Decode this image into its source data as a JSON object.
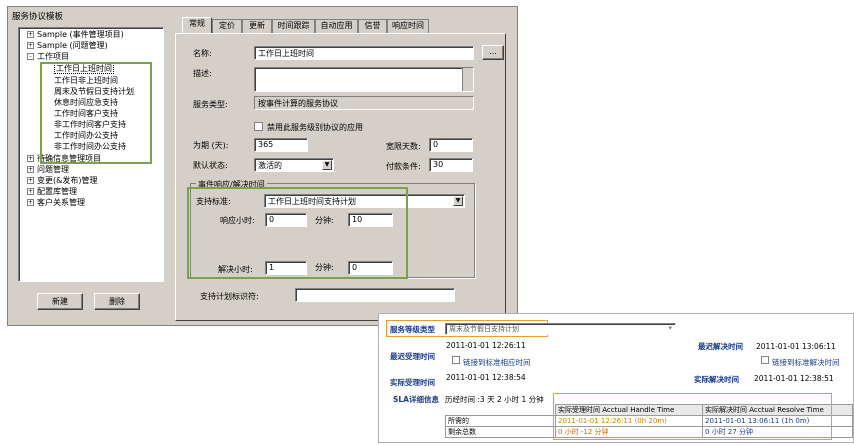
{
  "window": {
    "panel_title": "服务协议模板",
    "new_button": "新建",
    "delete_button": "删除"
  },
  "tree": {
    "items": [
      {
        "label": "Sample (事件管理项目)",
        "expander": "+"
      },
      {
        "label": "Sample (问题管理)",
        "expander": "+"
      },
      {
        "label": "工作项目",
        "expander": "-"
      },
      {
        "label": "工作日上班时间",
        "selected": true
      },
      {
        "label": "工作日非上班时间"
      },
      {
        "label": "周末及节假日支持计划"
      },
      {
        "label": "休息时间应急支持"
      },
      {
        "label": "工作时间客户支持"
      },
      {
        "label": "非工作时间客户支持"
      },
      {
        "label": "工作时间办公支持"
      },
      {
        "label": "非工作时间办公支持"
      },
      {
        "label": "待确信息管理项目",
        "expander": "+"
      },
      {
        "label": "问题管理",
        "expander": "+"
      },
      {
        "label": "变更(&发布)管理",
        "expander": "+"
      },
      {
        "label": "配置库管理",
        "expander": "+"
      },
      {
        "label": "客户关系管理",
        "expander": "+"
      }
    ]
  },
  "tabs": [
    "常规",
    "定价",
    "更新",
    "时间跟踪",
    "自动应用",
    "信誉",
    "响应时间"
  ],
  "form": {
    "name_label": "名称:",
    "name_value": "工作日上班时间",
    "browse_button": "...",
    "desc_label": "描述:",
    "desc_value": "",
    "service_type_label": "服务类型:",
    "service_type_value": "按事件计算的服务协议",
    "disable_label": "禁用此服务级别协议的应用",
    "period_label": "为期 (天):",
    "period_value": "365",
    "grace_label": "宽限天数:",
    "grace_value": "0",
    "default_state_label": "默认状态:",
    "default_state_value": "激活的",
    "payment_label": "付款条件:",
    "payment_value": "30",
    "group_title": "事件响应/解决时间",
    "support_label": "支持标准:",
    "support_value": "工作日上班时间支持计划",
    "resp_hours_label": "响应小时:",
    "resp_hours_value": "0",
    "resp_min_label": "分钟:",
    "resp_min_value": "10",
    "resolve_hours_label": "解决小时:",
    "resolve_hours_value": "1",
    "resolve_min_label": "分钟:",
    "resolve_min_value": "0",
    "plan_id_label": "支持计划标识符:",
    "plan_id_value": ""
  },
  "web": {
    "level_type_label": "服务等级类型",
    "level_type_value": "周末及节假日支持计划",
    "latest_handle_label": "最迟受理时间",
    "latest_handle_value": "2011-01-01 12:26:11",
    "link_handle_label": "链接到标准相应时间",
    "latest_resolve_label": "最迟解决时间",
    "latest_resolve_value": "2011-01-01 13:06:11",
    "link_resolve_label": "链接到标准解决时间",
    "actual_handle_label": "实际受理时间",
    "actual_handle_value": "2011-01-01 12:38:54",
    "actual_resolve_label": "实际解决时间",
    "actual_resolve_value": "2011-01-01 12:38:51",
    "sla_detail_label": "SLA详细信息",
    "elapsed_text": "历经时间 :3 天 2 小时 1 分钟",
    "table": {
      "col_handle": "实际受理时间   Acctual Handle Time",
      "col_resolve": "实际解决时间   Acctual Resolve Time",
      "row1_label": "所需的",
      "row1_handle": "2011-01-01 12:26:11 (0h 20m)",
      "row1_resolve": "2011-01-01 13:06:11 (1h 0m)",
      "row2_label": "剩余总数",
      "row2_handle": "0 小时 -12 分钟",
      "row2_resolve": "0 小时 27 分钟"
    }
  },
  "colors": {
    "green_highlight": "#7aa24a",
    "orange_highlight": "#e89a3c",
    "label_blue": "#1a3a8a"
  }
}
